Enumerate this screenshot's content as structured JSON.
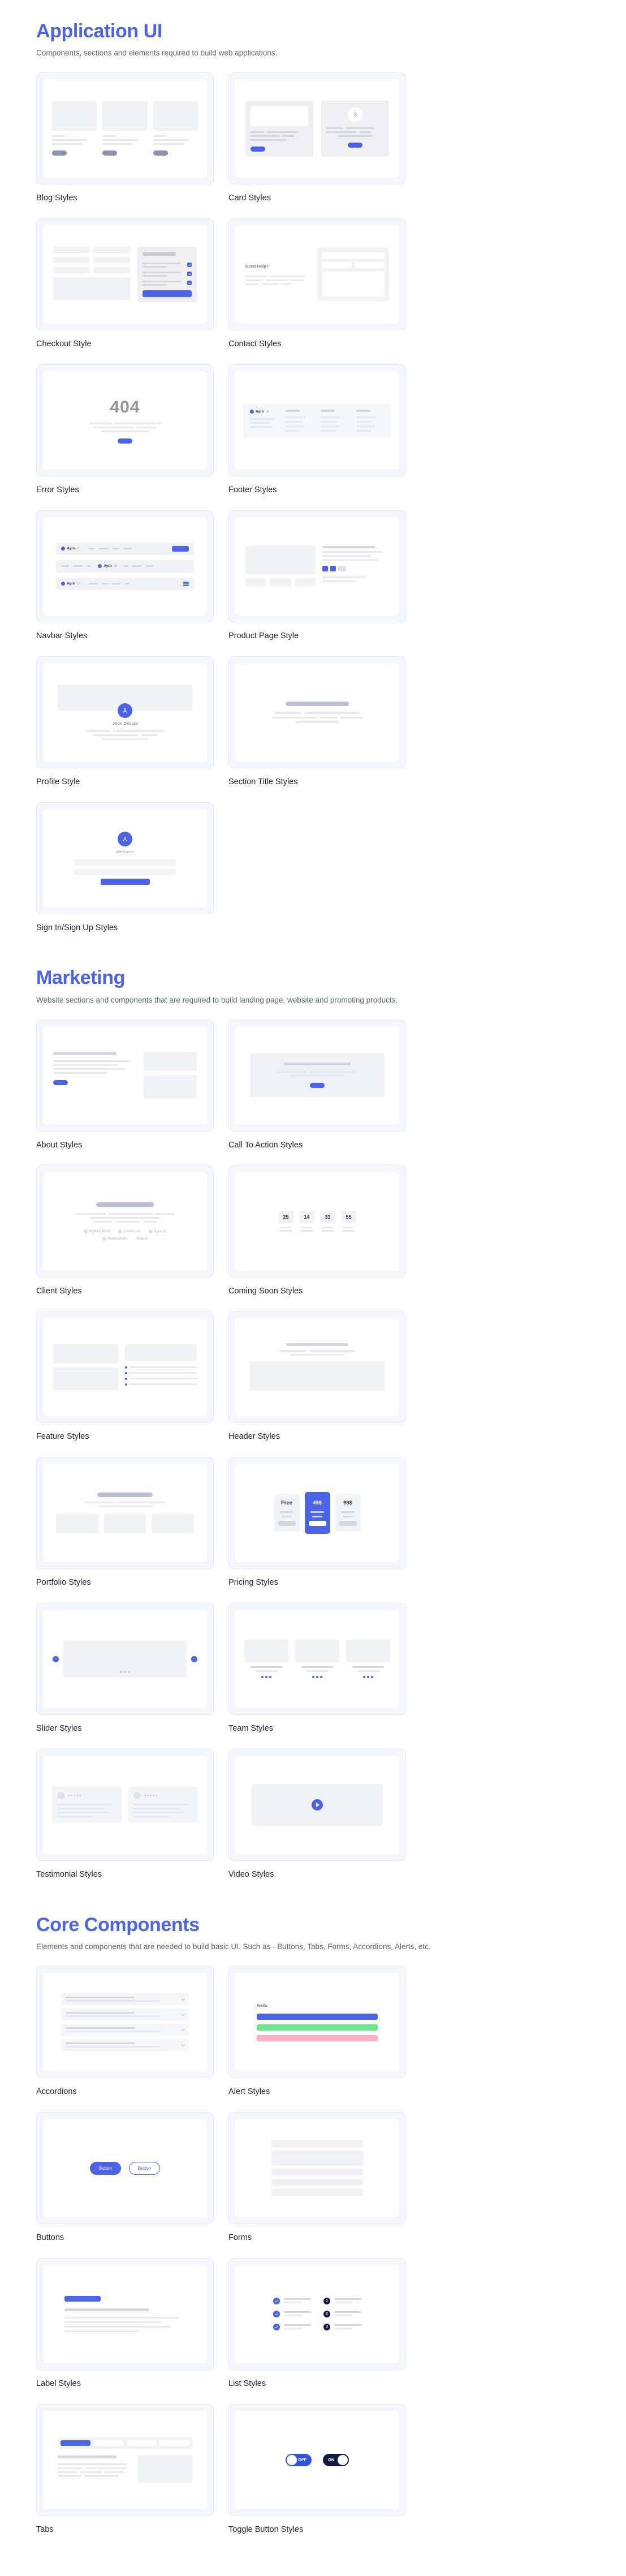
{
  "sections": [
    {
      "title": "Application UI",
      "subtitle": "Components, sections and elements required to build web applications.",
      "items": [
        {
          "label": "Blog Styles"
        },
        {
          "label": "Card Styles"
        },
        {
          "label": "Checkout Style"
        },
        {
          "label": "Contact Styles"
        },
        {
          "label": "Error Styles"
        },
        {
          "label": "Footer Styles"
        },
        {
          "label": "Navbar Styles"
        },
        {
          "label": "Product Page Style"
        },
        {
          "label": "Profile Style"
        },
        {
          "label": "Section Title Styles"
        },
        {
          "label": "Sign In/Sign Up Styles"
        }
      ]
    },
    {
      "title": "Marketing",
      "subtitle": "Website sections and components that are required to build landing page, website and promoting products.",
      "items": [
        {
          "label": "About Styles"
        },
        {
          "label": "Call To Action Styles"
        },
        {
          "label": "Client Styles"
        },
        {
          "label": "Coming Soon Styles"
        },
        {
          "label": "Feature Styles"
        },
        {
          "label": "Header Styles"
        },
        {
          "label": "Portfolio Styles"
        },
        {
          "label": "Pricing Styles"
        },
        {
          "label": "Slider Styles"
        },
        {
          "label": "Team Styles"
        },
        {
          "label": "Testimonial Styles"
        },
        {
          "label": "Video Styles"
        }
      ]
    },
    {
      "title": "Core Components",
      "subtitle": "Elements and components that are needed to build basic UI. Such as - Buttons, Tabs, Forms, Accordions, Alerts, etc.",
      "items": [
        {
          "label": "Accordions"
        },
        {
          "label": "Alert Styles"
        },
        {
          "label": "Buttons"
        },
        {
          "label": "Forms"
        },
        {
          "label": "Label Styles"
        },
        {
          "label": "List Styles"
        },
        {
          "label": "Tabs"
        },
        {
          "label": "Toggle Button Styles"
        }
      ]
    }
  ],
  "thumbnails": {
    "contact": {
      "heading": "Need Help?"
    },
    "error": {
      "code": "404"
    },
    "navbar": {
      "brand_bold": "Ayro",
      "brand_light": "UI"
    },
    "profile": {
      "name": "Jhon Desuja"
    },
    "signin": {
      "greeting": "Welcome"
    },
    "client": {
      "logos": [
        "GRAYGRIDS",
        "Lineicons",
        "Ayro UI",
        "PlainAdmin",
        "UIdeck"
      ]
    },
    "coming_soon": {
      "counters": [
        "25",
        "14",
        "33",
        "55"
      ]
    },
    "pricing": {
      "plans": [
        "Free",
        "49$",
        "99$"
      ],
      "highlighted_index": 1
    },
    "alerts": {
      "heading": "Alerts",
      "colors": [
        "#4a63e7",
        "#6ee48b",
        "#ffb0c3"
      ]
    },
    "buttons": {
      "solid_label": "Button",
      "outline_label": "Button"
    },
    "list": {
      "numbers": [
        "1",
        "2",
        "3"
      ]
    },
    "toggle": {
      "off_label": "OFF",
      "on_label": "ON"
    }
  },
  "colors": {
    "accent": "#4a63e7",
    "heading": "#1d2333",
    "muted": "#5a6270",
    "thumb_frame": "#f3f6fd",
    "dark": "#141b43"
  }
}
